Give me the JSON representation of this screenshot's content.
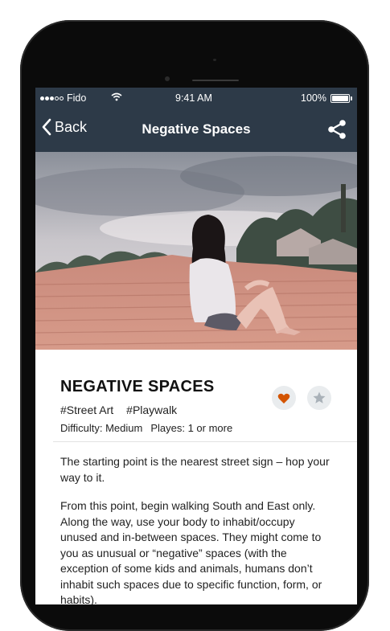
{
  "status_bar": {
    "carrier": "Fido",
    "time": "9:41 AM",
    "battery": "100%"
  },
  "nav": {
    "back_label": "Back",
    "title": "Negative Spaces"
  },
  "activity": {
    "title": "NEGATIVE SPACES",
    "tags": [
      "#Street Art",
      "#Playwalk"
    ],
    "difficulty": "Difficulty: Medium",
    "players": "Playes: 1 or more"
  },
  "description": {
    "paragraph_1": "The starting point is the nearest street sign – hop your way to it.",
    "paragraph_2": "From this point, begin walking South and East only. Along the way, use your body to inhabit/occupy unused and in-between spaces. They might come to you as unusual or “negative” spaces (with the exception of some kids and animals, humans don’t inhabit such spaces due to specific function, form, or habits)."
  },
  "colors": {
    "nav_bg": "#2d3a48",
    "heart": "#d35400",
    "star": "#a9b1b8"
  },
  "icons": {
    "back": "chevron-left-icon",
    "share": "share-icon",
    "favorite": "heart-icon",
    "rate": "star-icon"
  }
}
